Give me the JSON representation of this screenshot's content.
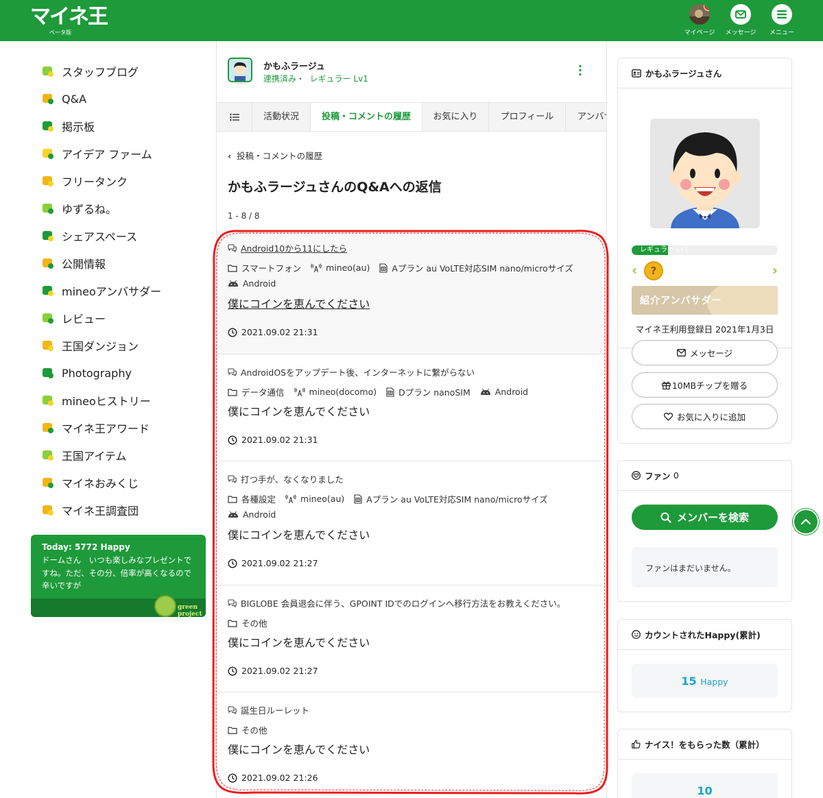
{
  "header": {
    "logo": "マイネ王",
    "beta": "ベータ版",
    "nav": [
      {
        "label": "マイページ",
        "badge": "!"
      },
      {
        "label": "メッセージ"
      },
      {
        "label": "メニュー"
      }
    ]
  },
  "sidebar": {
    "items": [
      {
        "label": "スタッフブログ",
        "icon": "staff-blog-icon"
      },
      {
        "label": "Q&A",
        "icon": "qa-icon"
      },
      {
        "label": "掲示板",
        "icon": "board-icon"
      },
      {
        "label": "アイデア ファーム",
        "icon": "idea-icon"
      },
      {
        "label": "フリータンク",
        "icon": "tank-icon"
      },
      {
        "label": "ゆずるね。",
        "icon": "yuzurune-icon"
      },
      {
        "label": "シェアスペース",
        "icon": "share-space-icon"
      },
      {
        "label": "公開情報",
        "icon": "chart-icon"
      },
      {
        "label": "mineoアンバサダー",
        "icon": "ambassador-icon"
      },
      {
        "label": "レビュー",
        "icon": "review-icon"
      },
      {
        "label": "王国ダンジョン",
        "icon": "dungeon-icon"
      },
      {
        "label": "Photography",
        "icon": "camera-icon"
      },
      {
        "label": "mineoヒストリー",
        "icon": "history-icon"
      },
      {
        "label": "マイネ王アワード",
        "icon": "trophy-icon"
      },
      {
        "label": "王国アイテム",
        "icon": "item-icon"
      },
      {
        "label": "マイネおみくじ",
        "icon": "torii-icon"
      },
      {
        "label": "マイネ王調査団",
        "icon": "survey-icon"
      }
    ],
    "banner": {
      "title": "Today: 5772 Happy",
      "text": "ドームさん　いつも楽しみなプレゼントですね。ただ、その分、倍率が高くなるので辛いですが",
      "brand": "green project"
    }
  },
  "profile_header": {
    "name": "かもふラージュ",
    "linked": "連携済み",
    "separator": "・",
    "rank": "レギュラー Lv1"
  },
  "tabs": [
    {
      "label": "☰"
    },
    {
      "label": "活動状況"
    },
    {
      "label": "投稿・コメントの履歴",
      "active": true
    },
    {
      "label": "お気に入り"
    },
    {
      "label": "プロフィール"
    },
    {
      "label": "アンバサダー"
    }
  ],
  "breadcrumb": "投稿・コメントの履歴",
  "page_title": "かもふラージュさんのQ&Aへの返信",
  "result_count": "1 - 8 / 8",
  "replies": [
    {
      "title": "Android10から11にしたら",
      "category": "スマートフォン",
      "carrier": "mineo(au)",
      "plan": "Aプラン au VoLTE対応SIM nano/microサイズ",
      "os": "Android",
      "body": "僕にコインを恵んでください",
      "time": "2021.09.02 21:31"
    },
    {
      "title": "AndroidOSをアップデート後、インターネットに繋がらない",
      "category": "データ通信",
      "carrier": "mineo(docomo)",
      "plan": "Dプラン nanoSIM",
      "os": "Android",
      "body": "僕にコインを恵んでください",
      "time": "2021.09.02 21:31"
    },
    {
      "title": "打つ手が、なくなりました",
      "category": "各種設定",
      "carrier": "mineo(au)",
      "plan": "Aプラン au VoLTE対応SIM nano/microサイズ",
      "os": "Android",
      "body": "僕にコインを恵んでください",
      "time": "2021.09.02 21:27"
    },
    {
      "title": "BIGLOBE 会員退会に伴う、GPOINT IDでのログインへ移行方法をお教えください。",
      "category": "その他",
      "body": "僕にコインを恵んでください",
      "time": "2021.09.02 21:27"
    },
    {
      "title": "誕生日ルーレット",
      "category": "その他",
      "body": "僕にコインを恵んでください",
      "time": "2021.09.02 21:26"
    }
  ],
  "profile_card": {
    "title": "かもふラージュさん",
    "level_label": "レギュラー Lv1",
    "level_progress": 0.25,
    "badge": "?",
    "ambassador": "紹介アンバサダー",
    "registered": "マイネ王利用登録日 2021年1月3日",
    "buttons": {
      "message": "メッセージ",
      "gift": "10MBチップを贈る",
      "favorite": "お気に入りに追加"
    }
  },
  "fan_card": {
    "title": "ファン",
    "count": "0",
    "search_button": "メンバーを検索",
    "empty": "ファンはまだいません。"
  },
  "happy_card": {
    "title": "カウントされたHappy(累計)",
    "value": "15",
    "unit": "Happy"
  },
  "nice_card": {
    "title": "ナイス！をもらった数（累計）",
    "value": "10"
  },
  "colors": {
    "brand_green": "#1e9a3a",
    "happy_blue": "#19a3c8",
    "annotation_red": "#e8201e"
  }
}
